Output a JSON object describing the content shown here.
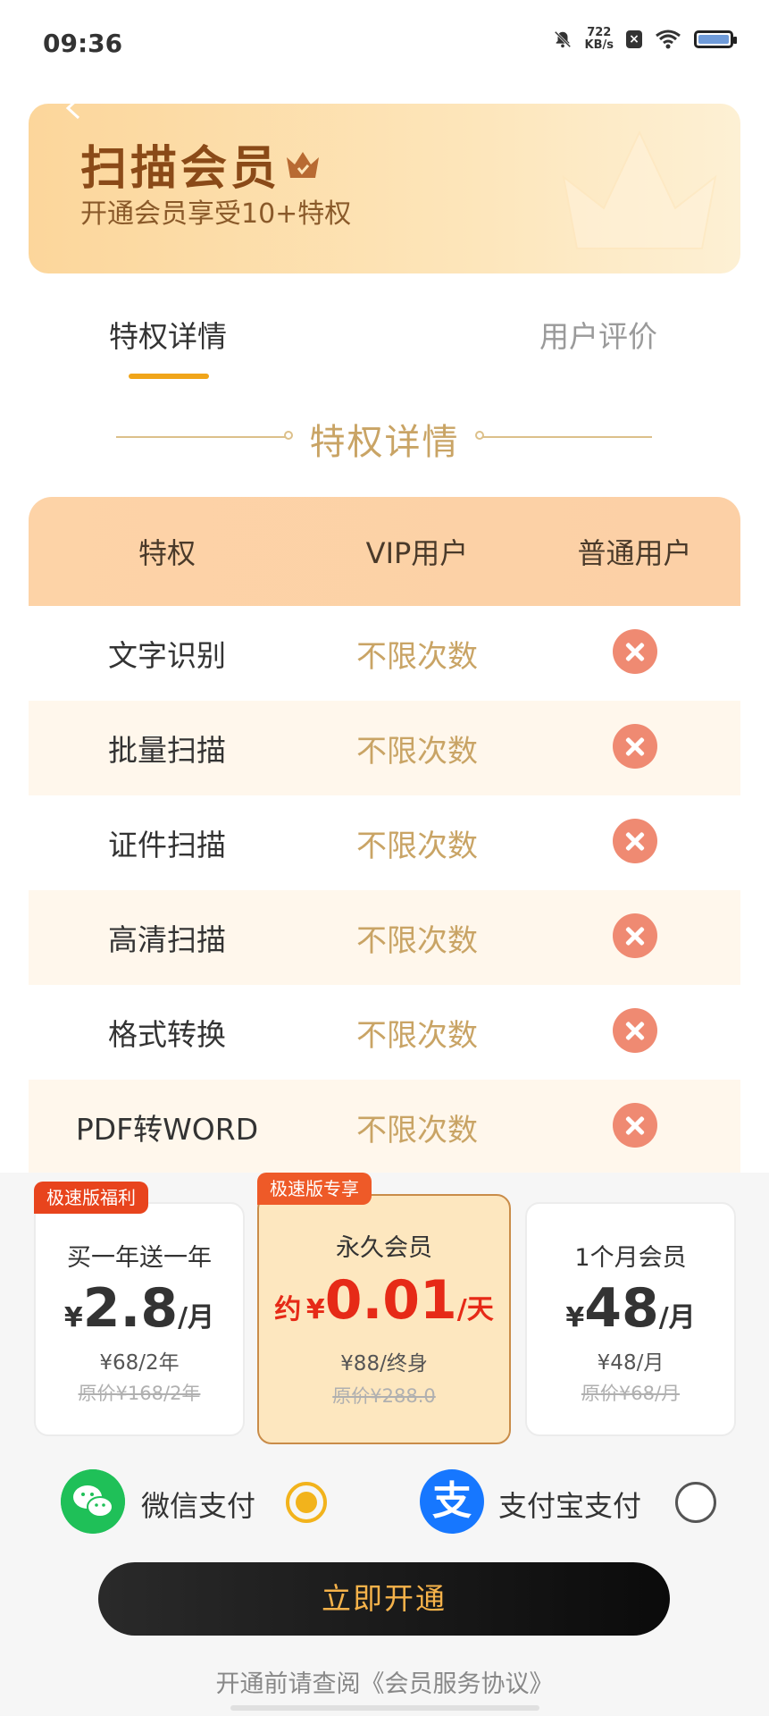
{
  "status": {
    "time": "09:36",
    "net_speed_value": "722",
    "net_speed_unit": "KB/s"
  },
  "header": {
    "title": "扫描会员",
    "subtitle": "开通会员享受10+特权"
  },
  "tabs": [
    {
      "label": "特权详情",
      "active": true
    },
    {
      "label": "用户评价",
      "active": false
    }
  ],
  "section": {
    "title": "特权详情"
  },
  "table": {
    "headers": [
      "特权",
      "VIP用户",
      "普通用户"
    ],
    "rows": [
      {
        "name": "文字识别",
        "vip": "不限次数"
      },
      {
        "name": "批量扫描",
        "vip": "不限次数"
      },
      {
        "name": "证件扫描",
        "vip": "不限次数"
      },
      {
        "name": "高清扫描",
        "vip": "不限次数"
      },
      {
        "name": "格式转换",
        "vip": "不限次数"
      },
      {
        "name": "PDF转WORD",
        "vip": "不限次数"
      }
    ]
  },
  "plans": [
    {
      "tag": "极速版福利",
      "name": "买一年送一年",
      "currency": "¥",
      "price": "2.8",
      "unit": "/月",
      "sub": "¥68/2年",
      "original": "原价¥168/2年"
    },
    {
      "tag": "极速版专享",
      "name": "永久会员",
      "prefix": "约",
      "currency": "¥",
      "price": "0.01",
      "unit": "/天",
      "sub": "¥88/终身",
      "original": "原价¥288.0"
    },
    {
      "name": "1个月会员",
      "currency": "¥",
      "price": "48",
      "unit": "/月",
      "sub": "¥48/月",
      "original": "原价¥68/月"
    }
  ],
  "payment": {
    "wechat_label": "微信支付",
    "alipay_label": "支付宝支付",
    "alipay_glyph": "支"
  },
  "cta": {
    "label": "立即开通"
  },
  "agreement": {
    "text": "开通前请查阅《会员服务协议》"
  },
  "colors": {
    "accent_gold": "#c9a465",
    "tab_indicator": "#f0a51a",
    "price_red": "#e62a17",
    "cta_bg": "#111111",
    "cta_text": "#f5b24a",
    "wechat_green": "#1fc058",
    "alipay_blue": "#1677ff",
    "cross_red": "#ef8a72"
  }
}
